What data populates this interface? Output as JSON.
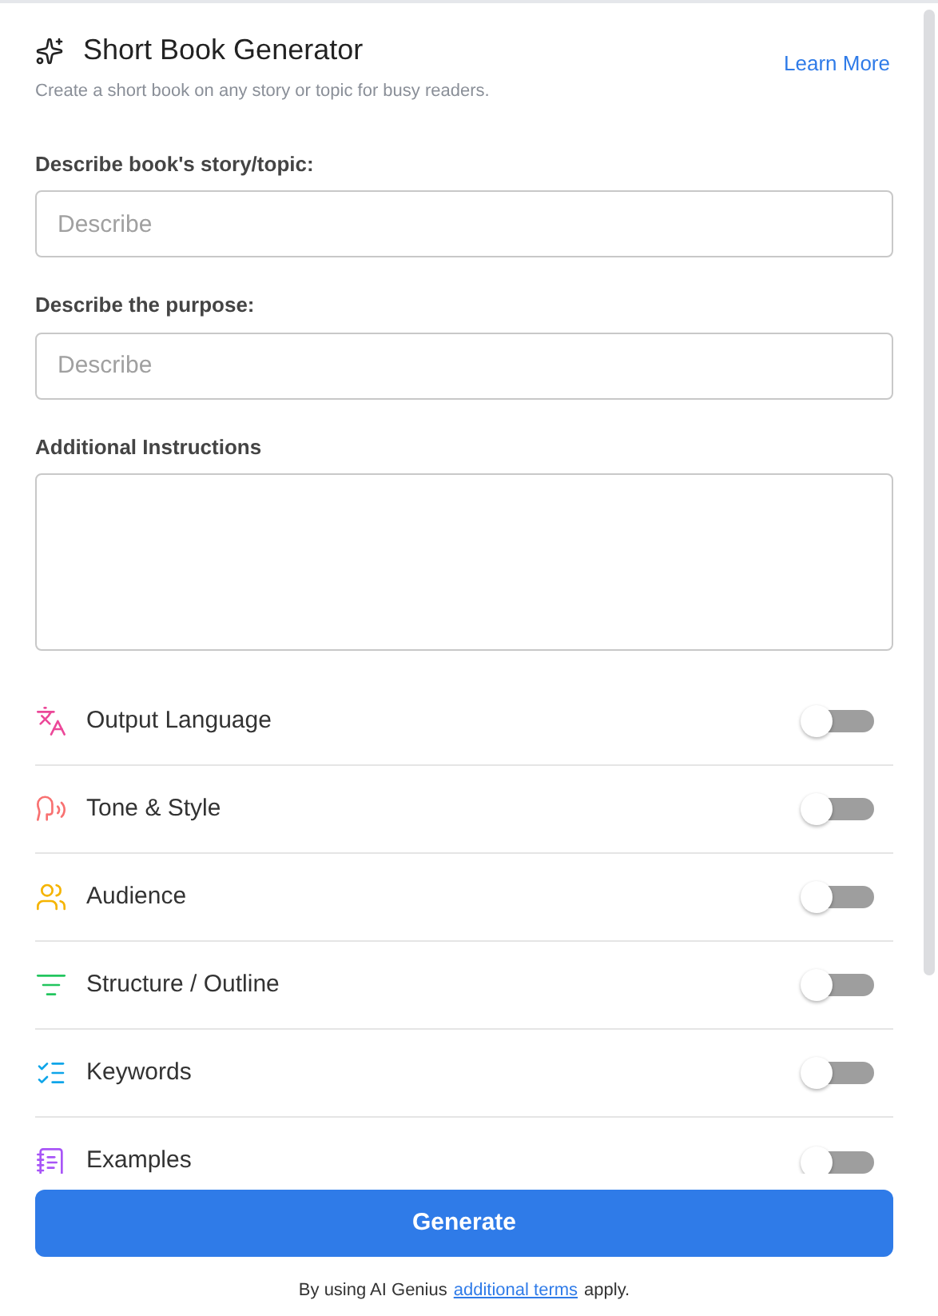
{
  "header": {
    "title": "Short Book Generator",
    "subtitle": "Create a short book on any story or topic for busy readers.",
    "link": "Learn More"
  },
  "fields": [
    {
      "kind": "input",
      "label": "Describe book's story/topic:",
      "placeholder": "Describe"
    },
    {
      "kind": "input",
      "label": "Describe the purpose:",
      "placeholder": "Describe"
    },
    {
      "kind": "textarea",
      "label": "Additional Instructions"
    }
  ],
  "options": [
    {
      "kind": "language",
      "label": "Output Language",
      "on": false
    },
    {
      "kind": "tone",
      "label": "Tone & Style",
      "on": false
    },
    {
      "kind": "audience",
      "label": "Audience",
      "on": false
    },
    {
      "kind": "structure",
      "label": "Structure / Outline",
      "on": false
    },
    {
      "kind": "keywords",
      "label": "Keywords",
      "on": false
    },
    {
      "kind": "examples",
      "label": "Examples",
      "on": false
    }
  ],
  "generate_button": "Generate",
  "footer": {
    "before": "By using AI Genius",
    "link": "additional terms",
    "after": "apply."
  }
}
